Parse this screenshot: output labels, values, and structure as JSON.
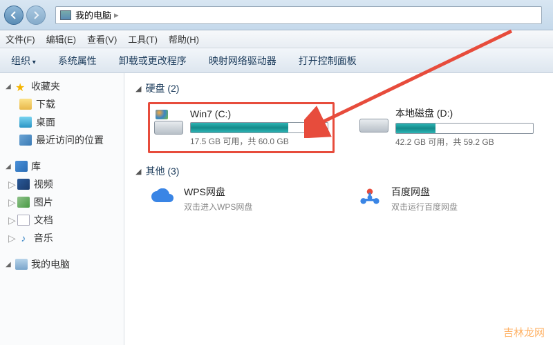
{
  "titlebar": {
    "location": "我的电脑",
    "separator": "  ▸"
  },
  "menu": {
    "file": "文件(F)",
    "edit": "编辑(E)",
    "view": "查看(V)",
    "tools": "工具(T)",
    "help": "帮助(H)"
  },
  "toolbar": {
    "organize": "组织",
    "sys_props": "系统属性",
    "uninstall": "卸载或更改程序",
    "map_drive": "映射网络驱动器",
    "control_panel": "打开控制面板"
  },
  "sidebar": {
    "favorites": {
      "header": "收藏夹",
      "items": [
        "下载",
        "桌面",
        "最近访问的位置"
      ]
    },
    "libraries": {
      "header": "库",
      "items": [
        "视频",
        "图片",
        "文档",
        "音乐"
      ]
    },
    "computer": {
      "header": "我的电脑"
    }
  },
  "content": {
    "section_disks": "硬盘 (2)",
    "section_other": "其他 (3)",
    "drives": [
      {
        "name": "Win7 (C:)",
        "stats": "17.5 GB 可用，共 60.0 GB",
        "fill_pct": 71
      },
      {
        "name": "本地磁盘 (D:)",
        "stats": "42.2 GB 可用，共 59.2 GB",
        "fill_pct": 29
      }
    ],
    "clouds": [
      {
        "name": "WPS网盘",
        "desc": "双击进入WPS网盘"
      },
      {
        "name": "百度网盘",
        "desc": "双击运行百度网盘"
      }
    ]
  },
  "watermark": "吉林龙网"
}
